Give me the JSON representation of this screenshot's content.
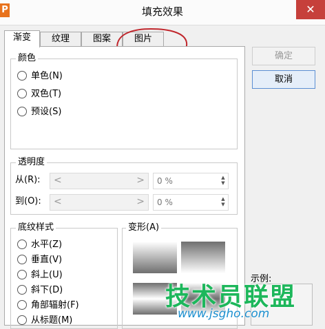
{
  "window": {
    "app_icon": "P",
    "title": "填充效果",
    "close": "✕"
  },
  "tabs": [
    {
      "label": "渐变",
      "active": true
    },
    {
      "label": "纹理",
      "active": false
    },
    {
      "label": "图案",
      "active": false
    },
    {
      "label": "图片",
      "active": false
    }
  ],
  "colors_group": {
    "title": "颜色",
    "options": [
      "单色(N)",
      "双色(T)",
      "预设(S)"
    ]
  },
  "transparency_group": {
    "title": "透明度",
    "from_label": "从(R):",
    "to_label": "到(O):",
    "from_value": "0 %",
    "to_value": "0 %"
  },
  "shading_group": {
    "title": "底纹样式",
    "options": [
      "水平(Z)",
      "垂直(V)",
      "斜上(U)",
      "斜下(D)",
      "角部辐射(F)",
      "从标题(M)"
    ]
  },
  "variants": {
    "title": "变形(A)"
  },
  "buttons": {
    "ok": "确定",
    "cancel": "取消"
  },
  "preview_label": "示例:",
  "watermark": {
    "text": "技术员联盟",
    "url": "www.jsgho.com"
  },
  "annotation_color": "#c0262c"
}
